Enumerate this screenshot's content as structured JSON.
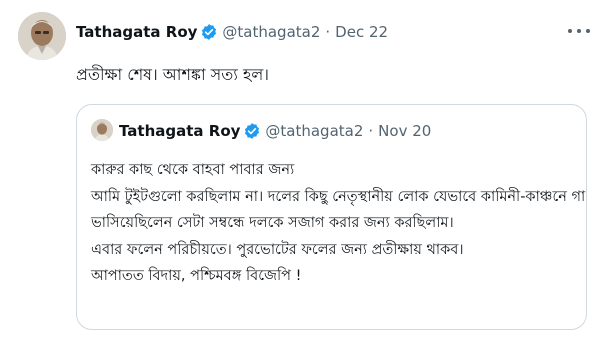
{
  "tweet": {
    "author_name": "Tathagata Roy",
    "handle": "@tathagata2",
    "separator": "·",
    "date": "Dec 22",
    "text": "প্রতীক্ষা শেষ। আশঙ্কা সত্য হল।",
    "avatar_icon": "profile-photo",
    "verified_icon": "verified-badge-icon",
    "more_icon": "more-options-icon"
  },
  "quoted": {
    "author_name": "Tathagata Roy",
    "handle": "@tathagata2",
    "separator": "·",
    "date": "Nov 20",
    "lines": [
      "কারুর কাছ থেকে বাহবা পাবার জন্য",
      "আমি টুইটগুলো করছিলাম না। দলের কিছু নেতৃস্থানীয় লোক যেভাবে কামিনী-কাঞ্চনে গা",
      "ভাসিয়েছিলেন সেটা সম্বন্ধে দলকে সজাগ করার জন্য করছিলাম।",
      "এবার ফলেন পরিচীয়তে। পুরভোটের ফলের জন্য প্রতীক্ষায় থাকব।",
      "আপাতত বিদায়, পশ্চিমবঙ্গ বিজেপি !"
    ]
  },
  "colors": {
    "text_primary": "#0f1419",
    "text_secondary": "#536471",
    "verified_blue": "#1d9bf0",
    "border": "#cfd9de"
  }
}
